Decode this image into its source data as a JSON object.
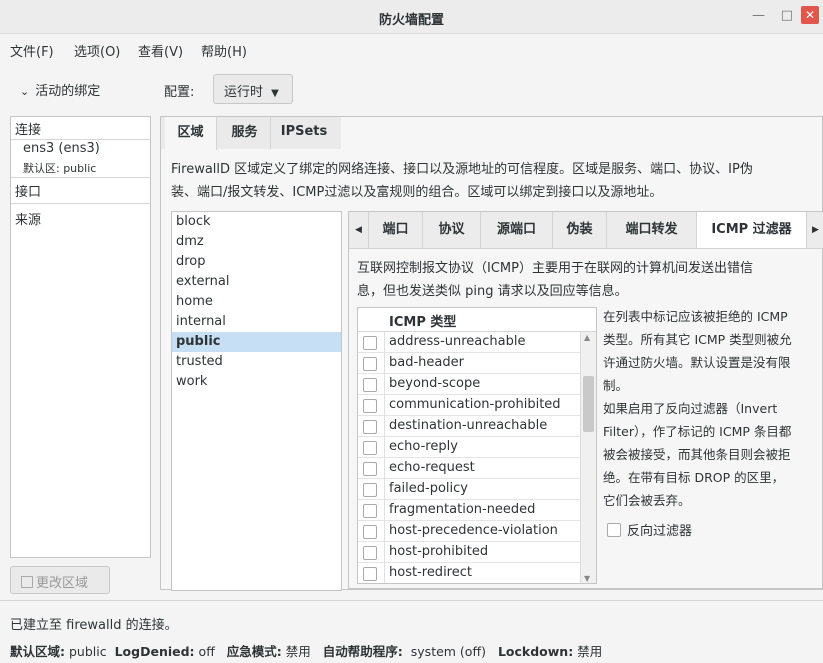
{
  "window": {
    "title": "防火墙配置",
    "min": "—",
    "max": "□",
    "close": "✕"
  },
  "menu": [
    "文件(F)",
    "选项(O)",
    "查看(V)",
    "帮助(H)"
  ],
  "binding": {
    "label": "活动的绑定"
  },
  "config": {
    "label": "配置:",
    "value": "运行时"
  },
  "left": {
    "connections_header": "连接",
    "conn_name": "ens3 (ens3)",
    "conn_zone": "默认区: public",
    "interfaces_header": "接口",
    "sources_header": "来源",
    "change_zone": "更改区域"
  },
  "tabs": [
    "区域",
    "服务",
    "IPSets"
  ],
  "zone_desc": [
    "FirewallD 区域定义了绑定的网络连接、接口以及源地址的可信程度。区域是服务、端口、协议、IP伪",
    "装、端口/报文转发、ICMP过滤以及富规则的组合。区域可以绑定到接口以及源地址。"
  ],
  "zones": [
    "block",
    "dmz",
    "drop",
    "external",
    "home",
    "internal",
    "public",
    "trusted",
    "work"
  ],
  "selected_zone": "public",
  "subtabs": [
    "端口",
    "协议",
    "源端口",
    "伪装",
    "端口转发",
    "ICMP 过滤器"
  ],
  "icmp_desc": [
    "互联网控制报文协议（ICMP）主要用于在联网的计算机间发送出错信",
    "息，但也发送类似 ping 请求以及回应等信息。"
  ],
  "icmp_header": "ICMP 类型",
  "icmp_types": [
    "address-unreachable",
    "bad-header",
    "beyond-scope",
    "communication-prohibited",
    "destination-unreachable",
    "echo-reply",
    "echo-request",
    "failed-policy",
    "fragmentation-needed",
    "host-precedence-violation",
    "host-prohibited",
    "host-redirect"
  ],
  "help_text": [
    "在列表中标记应该被拒绝的 ICMP",
    "类型。所有其它 ICMP 类型则被允",
    "许通过防火墙。默认设置是没有限",
    "制。",
    "如果启用了反向过滤器（Invert",
    "Filter），作了标记的 ICMP 条目都",
    "被会被接受，而其他条目则会被拒",
    "绝。在带有目标 DROP 的区里，",
    "它们会被丢弃。"
  ],
  "invert_filter": "反向过滤器",
  "status": {
    "connection": "已建立至 firewalld 的连接。",
    "default_zone_label": "默认区域:",
    "default_zone": "public",
    "logdenied_label": "LogDenied:",
    "logdenied": "off",
    "panic_label": "应急模式:",
    "panic": "禁用",
    "helper_label": "自动帮助程序:",
    "helper": "system (off)",
    "lockdown_label": "Lockdown:",
    "lockdown": "禁用"
  }
}
